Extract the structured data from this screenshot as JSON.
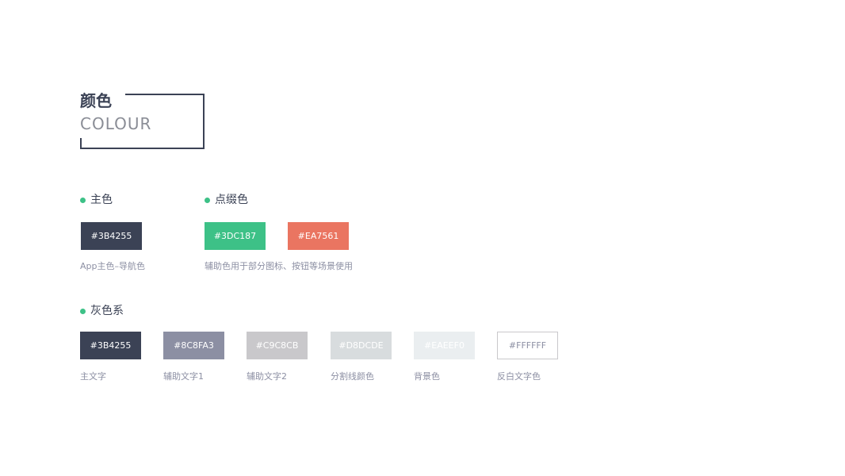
{
  "heading": {
    "cn": "颜色",
    "en": "COLOUR"
  },
  "primary": {
    "label": "主色",
    "swatch": {
      "text": "#3B4255",
      "color": "#3B4255",
      "text_color": "#FFFFFF"
    },
    "caption": "App主色–导航色"
  },
  "accent": {
    "label": "点缀色",
    "swatches": [
      {
        "text": "#3DC187",
        "color": "#3DC187",
        "text_color": "#FFFFFF"
      },
      {
        "text": "#EA7561",
        "color": "#EA7561",
        "text_color": "#FFFFFF"
      }
    ],
    "caption": "辅助色用于部分图标、按钮等场景使用"
  },
  "gray": {
    "label": "灰色系",
    "swatches": [
      {
        "text": "#3B4255",
        "color": "#3B4255",
        "text_color": "#FFFFFF",
        "caption": "主文字"
      },
      {
        "text": "#8C8FA3",
        "color": "#8C8FA3",
        "text_color": "#FFFFFF",
        "caption": "辅助文字1"
      },
      {
        "text": "#C9C8CB",
        "color": "#C9C8CB",
        "text_color": "#FFFFFF",
        "caption": "辅助文字2"
      },
      {
        "text": "#D8DCDE",
        "color": "#D8DCDE",
        "text_color": "#FFFFFF",
        "caption": "分割线颜色"
      },
      {
        "text": "#EAEEF0",
        "color": "#EAEEF0",
        "text_color": "#FFFFFF",
        "caption": "背景色"
      },
      {
        "text": "#FFFFFF",
        "color": "#FFFFFF",
        "text_color": "#8C8FA3",
        "border": "#C9C8CB",
        "caption": "反白文字色"
      }
    ]
  },
  "bullet_color": "#3DC187"
}
